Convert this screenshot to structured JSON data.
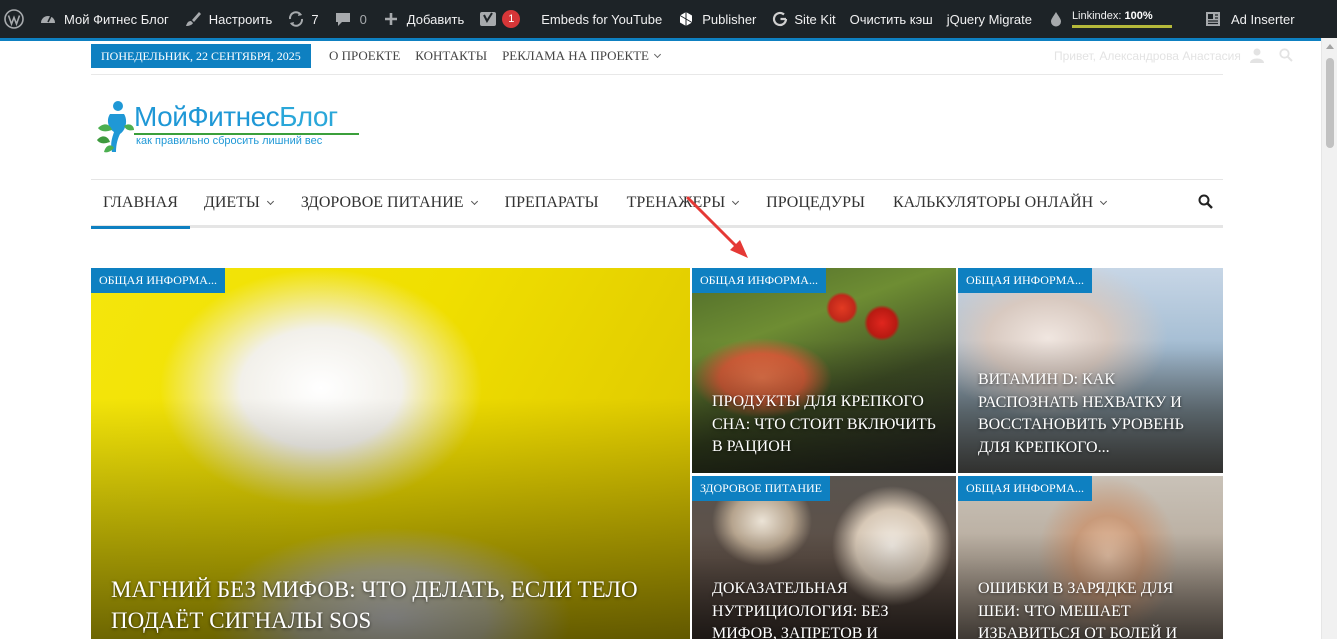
{
  "admin_bar": {
    "site_name": "Мой Фитнес Блог",
    "customize": "Настроить",
    "updates_count": "7",
    "comments_count": "0",
    "add_new": "Добавить",
    "yoast_badge": "1",
    "embeds": "Embeds for YouTube",
    "publisher": "Publisher",
    "site_kit": "Site Kit",
    "clear_cache": "Очистить кэш",
    "jquery_migrate": "jQuery Migrate",
    "linkindex_label": "Linkindex:",
    "linkindex_value": "100%",
    "linkindex_progress": 100,
    "ad_inserter": "Ad Inserter"
  },
  "top_bar": {
    "date": "ПОНЕДЕЛЬНИК, 22 СЕНТЯБРЯ, 2025",
    "links": [
      "О ПРОЕКТЕ",
      "КОНТАКТЫ",
      "РЕКЛАМА НА ПРОЕКТЕ"
    ],
    "greeting": "Привет, Александрова Анастасия"
  },
  "logo": {
    "title_part1": "МойФитнес",
    "title_part2": "Блог",
    "tagline": "как правильно сбросить лишний вес"
  },
  "main_nav": {
    "items": [
      {
        "label": "ГЛАВНАЯ",
        "active": true,
        "has_dropdown": false
      },
      {
        "label": "ДИЕТЫ",
        "active": false,
        "has_dropdown": true
      },
      {
        "label": "ЗДОРОВОЕ ПИТАНИЕ",
        "active": false,
        "has_dropdown": true
      },
      {
        "label": "ПРЕПАРАТЫ",
        "active": false,
        "has_dropdown": false
      },
      {
        "label": "ТРЕНАЖЕРЫ",
        "active": false,
        "has_dropdown": true
      },
      {
        "label": "ПРОЦЕДУРЫ",
        "active": false,
        "has_dropdown": false
      },
      {
        "label": "КАЛЬКУЛЯТОРЫ ОНЛАЙН",
        "active": false,
        "has_dropdown": true
      }
    ]
  },
  "posts": [
    {
      "category": "ОБЩАЯ ИНФОРМА...",
      "title": "МАГНИЙ БЕЗ МИФОВ: ЧТО ДЕЛАТЬ, ЕСЛИ ТЕЛО ПОДАЁТ СИГНАЛЫ SOS"
    },
    {
      "category": "ОБЩАЯ ИНФОРМА...",
      "title": "ПРОДУКТЫ ДЛЯ КРЕПКОГО СНА: ЧТО СТОИТ ВКЛЮЧИТЬ В РАЦИОН"
    },
    {
      "category": "ОБЩАЯ ИНФОРМА...",
      "title": "ВИТАМИН D: КАК РАСПОЗНАТЬ НЕХВАТКУ И ВОССТАНОВИТЬ УРОВЕНЬ ДЛЯ КРЕПКОГО..."
    },
    {
      "category": "ЗДОРОВОЕ ПИТАНИЕ",
      "title": "ДОКАЗАТЕЛЬНАЯ НУТРИЦИОЛОГИЯ: БЕЗ МИФОВ, ЗАПРЕТОВ И"
    },
    {
      "category": "ОБЩАЯ ИНФОРМА...",
      "title": "ОШИБКИ В ЗАРЯДКЕ ДЛЯ ШЕИ: ЧТО МЕШАЕТ ИЗБАВИТЬСЯ ОТ БОЛЕЙ И"
    }
  ],
  "colors": {
    "accent": "#0e80c1",
    "admin_bar_bg": "#1d2327",
    "annotation_arrow": "#e53935"
  }
}
